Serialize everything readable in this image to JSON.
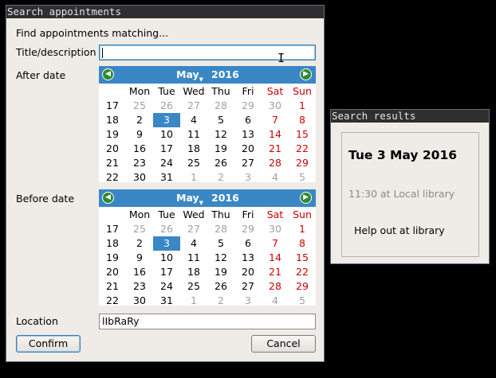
{
  "search_window": {
    "title": "Search appointments",
    "heading": "Find appointments matching...",
    "title_label": "Title/description",
    "title_value": "",
    "after_label": "After date",
    "before_label": "Before date",
    "location_label": "Location",
    "location_value": "lIbRaRy",
    "confirm_label": "Confirm",
    "cancel_label": "Cancel"
  },
  "calendar_after": {
    "month": "May",
    "year": "2016",
    "prev_icon": "◀",
    "next_icon": "▶",
    "weekday_headers": [
      "Mon",
      "Tue",
      "Wed",
      "Thu",
      "Fri",
      "Sat",
      "Sun"
    ],
    "weeks": [
      {
        "week": "17",
        "days": [
          "25",
          "26",
          "27",
          "28",
          "29",
          "30",
          "1"
        ]
      },
      {
        "week": "18",
        "days": [
          "2",
          "3",
          "4",
          "5",
          "6",
          "7",
          "8"
        ]
      },
      {
        "week": "19",
        "days": [
          "9",
          "10",
          "11",
          "12",
          "13",
          "14",
          "15"
        ]
      },
      {
        "week": "20",
        "days": [
          "16",
          "17",
          "18",
          "19",
          "20",
          "21",
          "22"
        ]
      },
      {
        "week": "21",
        "days": [
          "23",
          "24",
          "25",
          "26",
          "27",
          "28",
          "29"
        ]
      },
      {
        "week": "22",
        "days": [
          "30",
          "31",
          "1",
          "2",
          "3",
          "4",
          "5"
        ]
      }
    ],
    "selected_day": "3"
  },
  "calendar_before": {
    "month": "May",
    "year": "2016",
    "prev_icon": "◀",
    "next_icon": "▶",
    "weekday_headers": [
      "Mon",
      "Tue",
      "Wed",
      "Thu",
      "Fri",
      "Sat",
      "Sun"
    ],
    "weeks": [
      {
        "week": "17",
        "days": [
          "25",
          "26",
          "27",
          "28",
          "29",
          "30",
          "1"
        ]
      },
      {
        "week": "18",
        "days": [
          "2",
          "3",
          "4",
          "5",
          "6",
          "7",
          "8"
        ]
      },
      {
        "week": "19",
        "days": [
          "9",
          "10",
          "11",
          "12",
          "13",
          "14",
          "15"
        ]
      },
      {
        "week": "20",
        "days": [
          "16",
          "17",
          "18",
          "19",
          "20",
          "21",
          "22"
        ]
      },
      {
        "week": "21",
        "days": [
          "23",
          "24",
          "25",
          "26",
          "27",
          "28",
          "29"
        ]
      },
      {
        "week": "22",
        "days": [
          "30",
          "31",
          "1",
          "2",
          "3",
          "4",
          "5"
        ]
      }
    ],
    "selected_day": "3"
  },
  "results_window": {
    "title": "Search results",
    "date": "Tue 3 May 2016",
    "time_location": "11:30 at Local library",
    "description": "Help out at library"
  },
  "colors": {
    "calendar_header": "#3a87c6",
    "selected_day": "#3a87c6",
    "weekend": "#cc0000",
    "other_month": "#a0a0a0",
    "nav_button": "#2f8a2f",
    "window_bg": "#efebe7",
    "titlebar": "#2f2f2f"
  }
}
